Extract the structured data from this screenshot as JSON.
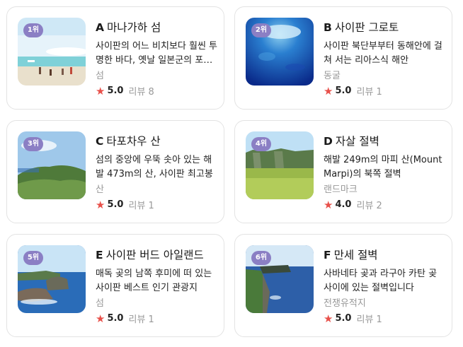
{
  "places": [
    {
      "rank": "1위",
      "letter": "A",
      "name": "마나가하 섬",
      "desc": "사이판의 어느 비치보다 훨씬 투명한 바다, 옛날 일본군의 포대 유적지가 남아있는 섬",
      "category": "섬",
      "score": "5.0",
      "reviews": "리뷰 8",
      "image": "beach-island-photo"
    },
    {
      "rank": "2위",
      "letter": "B",
      "name": "사이판 그로토",
      "desc": "사이판 북단부부터 동해안에 걸쳐 서는 리아스식 해안",
      "category": "동굴",
      "score": "5.0",
      "reviews": "리뷰 1",
      "image": "underwater-grotto-photo"
    },
    {
      "rank": "3위",
      "letter": "C",
      "name": "타포차우 산",
      "desc": "섬의 중앙에 우뚝 솟아 있는 해발 473m의 산, 사이판 최고봉",
      "category": "산",
      "score": "5.0",
      "reviews": "리뷰 1",
      "image": "mountain-view-photo"
    },
    {
      "rank": "4위",
      "letter": "D",
      "name": "자살 절벽",
      "desc": "해발 249m의 마피 산(Mount Marpi)의 북쪽 절벽",
      "category": "랜드마크",
      "score": "4.0",
      "reviews": "리뷰 2",
      "image": "cliff-meadow-photo"
    },
    {
      "rank": "5위",
      "letter": "E",
      "name": "사이판 버드 아일랜드",
      "desc": "매독 곶의 남쪽 후미에 떠 있는 사이판 베스트 인기 관광지",
      "category": "섬",
      "score": "5.0",
      "reviews": "리뷰 1",
      "image": "bird-island-photo"
    },
    {
      "rank": "6위",
      "letter": "F",
      "name": "만세 절벽",
      "desc": "사바네타 곶과 라구아 카탄 곶 사이에 있는 절벽입니다",
      "category": "전쟁유적지",
      "score": "5.0",
      "reviews": "리뷰 1",
      "image": "banzai-cliff-photo"
    }
  ],
  "colors": {
    "star": "#e8504a",
    "rank_badge": "#8b7fc4"
  }
}
